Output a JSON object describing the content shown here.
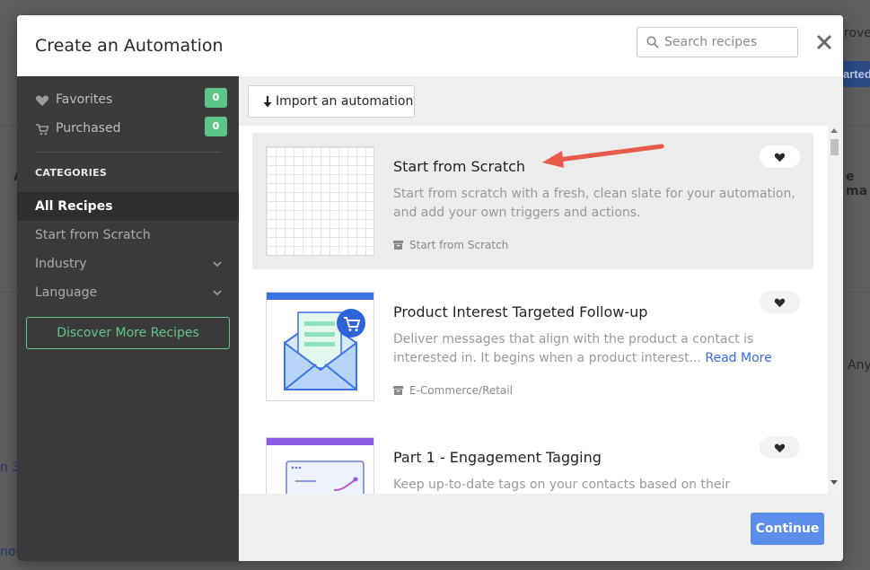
{
  "background": {
    "fragments": [
      "rove",
      "arted",
      "e ma",
      "Any",
      "n 3",
      "non",
      "A"
    ]
  },
  "modal": {
    "title": "Create an Automation",
    "search_placeholder": "Search recipes",
    "close_label": "close"
  },
  "sidebar": {
    "favorites": {
      "label": "Favorites",
      "count": "0"
    },
    "purchased": {
      "label": "Purchased",
      "count": "0"
    },
    "categories_heading": "CATEGORIES",
    "categories": [
      {
        "label": "All Recipes",
        "active": true
      },
      {
        "label": "Start from Scratch"
      },
      {
        "label": "Industry",
        "expandable": true
      },
      {
        "label": "Language",
        "expandable": true
      }
    ],
    "discover_label": "Discover More Recipes"
  },
  "main": {
    "import_label": "Import an automation",
    "recipes": [
      {
        "title": "Start from Scratch",
        "description": "Start from scratch with a fresh, clean slate for your automation, and add your own triggers and actions.",
        "category": "Start from Scratch",
        "selected": true
      },
      {
        "title": "Product Interest Targeted Follow-up",
        "description": "Deliver messages that align with the product a contact is interested in. It begins when a product interest...",
        "read_more": "Read More",
        "category": "E-Commerce/Retail",
        "accent": "#3b73e6"
      },
      {
        "title": "Part 1 - Engagement Tagging",
        "description": "Keep up-to-date tags on your contacts based on their engagement level.",
        "accent": "#8a5ce6"
      }
    ],
    "continue_label": "Continue"
  },
  "colors": {
    "accent_green": "#5fc48a",
    "primary_blue": "#5b8ee8",
    "annotation_red": "#e85a4a"
  }
}
